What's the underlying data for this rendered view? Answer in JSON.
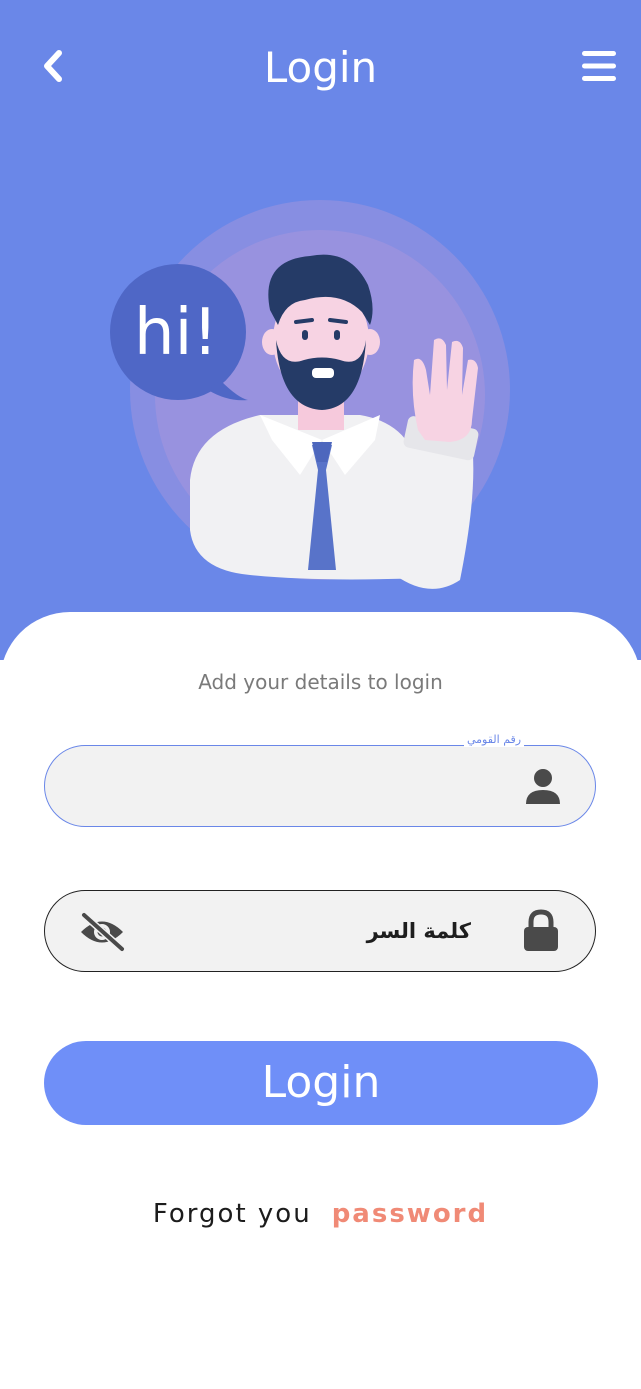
{
  "header": {
    "title": "Login",
    "back_icon": "chevron-left-icon",
    "menu_icon": "hamburger-menu-icon"
  },
  "illustration": {
    "speech_bubble_text": "hi!"
  },
  "form": {
    "subtitle": "Add your details to login",
    "national_id_label": "رقم القومي",
    "national_id_value": "",
    "national_id_icon": "user-icon",
    "password_value": "كلمة السر",
    "password_icon": "lock-icon",
    "visibility_icon": "eye-off-icon",
    "login_button_label": "Login",
    "forgot_text": "Forgot you",
    "forgot_link": "password"
  },
  "colors": {
    "primary": "#6a87e8",
    "button": "#6f8ff8",
    "link": "#f08a76",
    "field_bg": "#f2f2f2"
  }
}
